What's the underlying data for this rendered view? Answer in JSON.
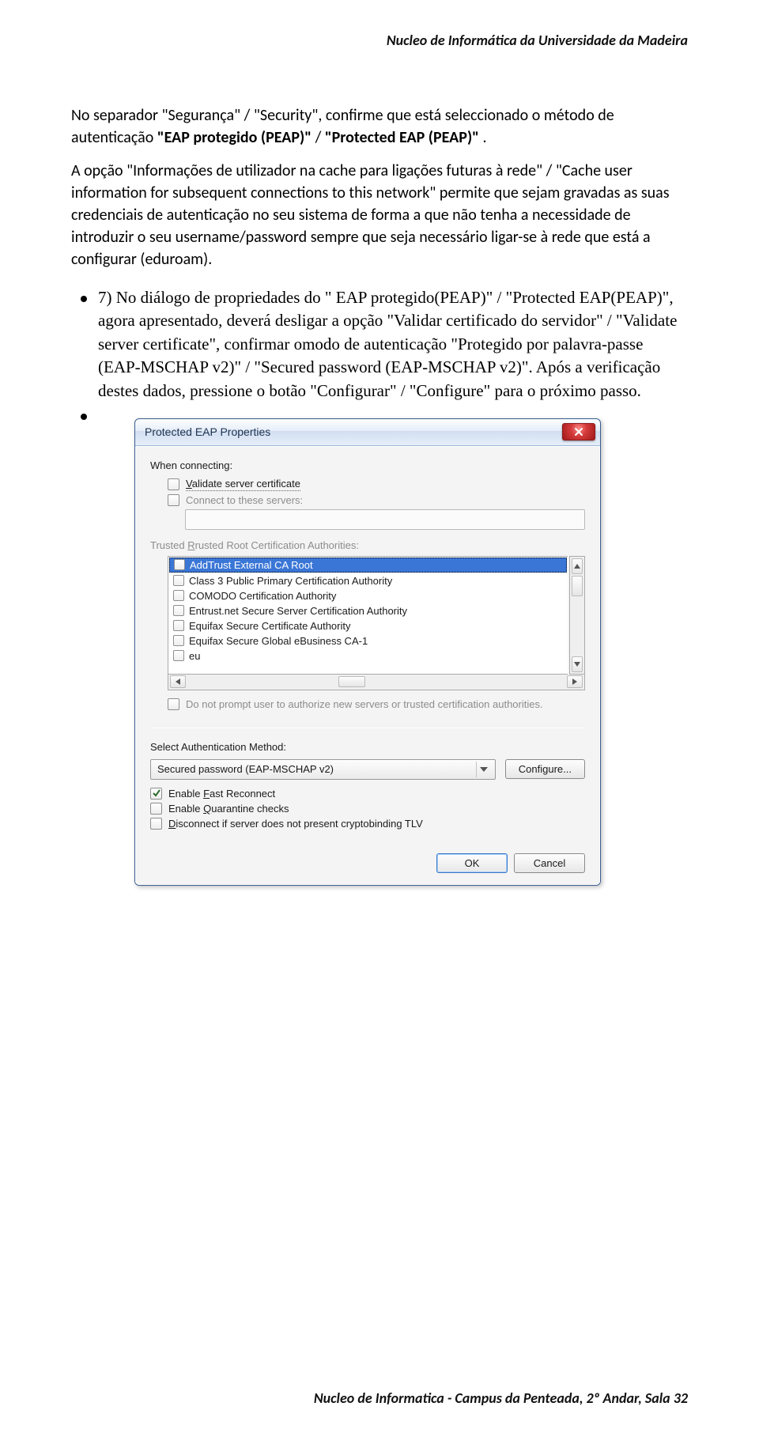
{
  "header": "Nucleo de Informática da Universidade da Madeira",
  "para1_prefix": "No separador \"Segurança\" / \"Security\", confirme que está seleccionado o método de autenticação ",
  "para1_bold1": "\"EAP protegido (PEAP)\"",
  "para1_mid": " / ",
  "para1_bold2": "\"Protected EAP (PEAP)\"",
  "para1_suffix": ".",
  "para2": "A opção \"Informações de utilizador na cache para ligações futuras à rede\" / \"Cache user information for subsequent connections to this network\" permite que sejam gravadas as suas credenciais de autenticação no seu sistema de forma a que não tenha a necessidade de introduzir o seu username/password sempre que seja necessário ligar-se à rede que está a configurar (eduroam).",
  "bullet1": "7) No diálogo de propriedades do \" EAP protegido(PEAP)\" / \"Protected EAP(PEAP)\", agora apresentado, deverá desligar a opção \"Validar certificado do servidor\" / \"Validate server certificate\", confirmar omodo de autenticação \"Protegido por palavra-passe (EAP-MSCHAP v2)\" / \"Secured password (EAP-MSCHAP v2)\". Após a verificação destes dados, pressione o botão \"Configurar\" / \"Configure\" para o próximo passo.",
  "dialog": {
    "title": "Protected EAP Properties",
    "when_connecting": "When connecting:",
    "validate_cert": "Validate server certificate",
    "connect_servers": "Connect to these servers:",
    "servers_value": "",
    "trusted_label": "Trusted Root Certification Authorities:",
    "ca_list": [
      "AddTrust External CA Root",
      "Class 3 Public Primary Certification Authority",
      "COMODO Certification Authority",
      "Entrust.net Secure Server Certification Authority",
      "Equifax Secure Certificate Authority",
      "Equifax Secure Global eBusiness CA-1",
      "eu"
    ],
    "no_prompt": "Do not prompt user to authorize new servers or trusted certification authorities.",
    "auth_method_label": "Select Authentication Method:",
    "auth_method_value": "Secured password (EAP-MSCHAP v2)",
    "configure_btn": "Configure...",
    "fast_reconnect": "Enable Fast Reconnect",
    "quarantine": "Enable Quarantine checks",
    "disconnect_tlv": "Disconnect if server does not present cryptobinding TLV",
    "ok": "OK",
    "cancel": "Cancel"
  },
  "footer": "Nucleo de Informatica - Campus da Penteada, 2º Andar, Sala 32"
}
